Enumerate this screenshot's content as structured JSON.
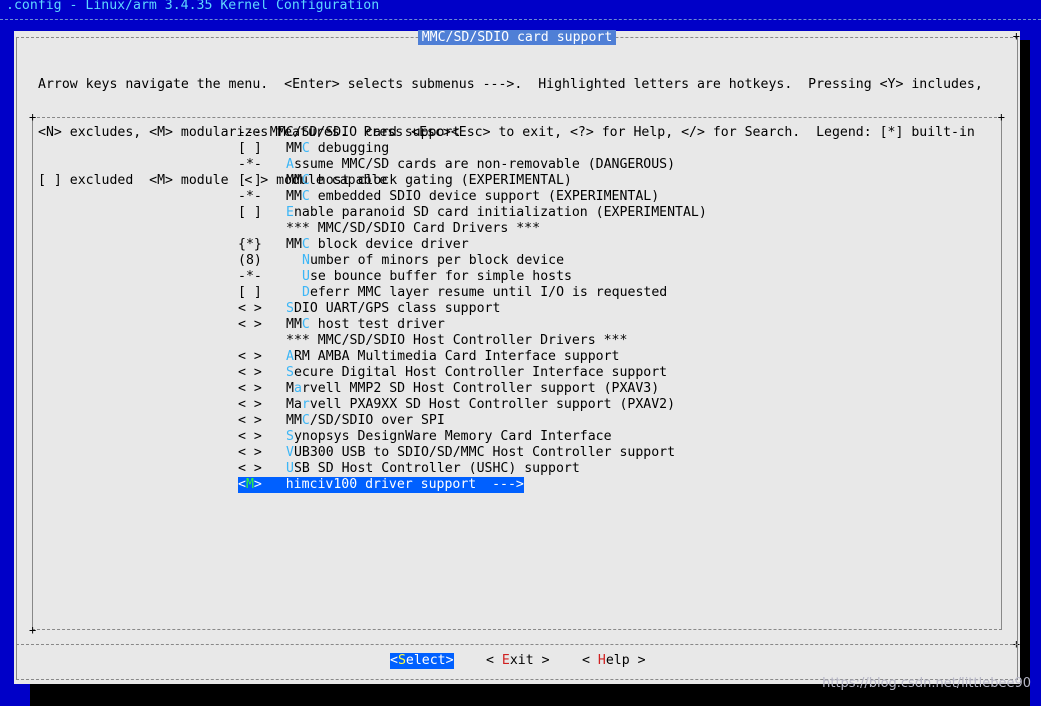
{
  "window": {
    "title": ".config - Linux/arm 3.4.35 Kernel Configuration"
  },
  "dialog": {
    "title": "MMC/SD/SDIO card support",
    "help_lines": [
      "Arrow keys navigate the menu.  <Enter> selects submenus --->.  Highlighted letters are hotkeys.  Pressing <Y> includes,",
      "<N> excludes, <M> modularizes features.  Press <Esc><Esc> to exit, <?> for Help, </> for Search.  Legend: [*] built-in",
      "[ ] excluded  <M> module  < > module capable"
    ]
  },
  "menu": {
    "items": [
      {
        "mark": "",
        "pre": "--- MMC/SD/SDIO card support",
        "hk": "",
        "post": "",
        "indent": false,
        "raw": true
      },
      {
        "mark": "[ ]",
        "pre": "MM",
        "hk": "C",
        "post": " debugging",
        "indent": false
      },
      {
        "mark": "-*-",
        "pre": "",
        "hk": "A",
        "post": "ssume MMC/SD cards are non-removable (DANGEROUS)",
        "indent": false
      },
      {
        "mark": "[ ]",
        "pre": "MM",
        "hk": "C",
        "post": " host clock gating (EXPERIMENTAL)",
        "indent": false
      },
      {
        "mark": "-*-",
        "pre": "MM",
        "hk": "C",
        "post": " embedded SDIO device support (EXPERIMENTAL)",
        "indent": false
      },
      {
        "mark": "[ ]",
        "pre": "",
        "hk": "E",
        "post": "nable paranoid SD card initialization (EXPERIMENTAL)",
        "indent": false
      },
      {
        "mark": "",
        "pre": "*** MMC/SD/SDIO Card Drivers ***",
        "hk": "",
        "post": "",
        "indent": false
      },
      {
        "mark": "{*}",
        "pre": "MM",
        "hk": "C",
        "post": " block device driver",
        "indent": false
      },
      {
        "mark": "(8)",
        "pre": "",
        "hk": "N",
        "post": "umber of minors per block device",
        "indent": true
      },
      {
        "mark": "-*-",
        "pre": "",
        "hk": "U",
        "post": "se bounce buffer for simple hosts",
        "indent": true
      },
      {
        "mark": "[ ]",
        "pre": "",
        "hk": "D",
        "post": "eferr MMC layer resume until I/O is requested",
        "indent": true
      },
      {
        "mark": "< >",
        "pre": "",
        "hk": "S",
        "post": "DIO UART/GPS class support",
        "indent": false
      },
      {
        "mark": "< >",
        "pre": "MM",
        "hk": "C",
        "post": " host test driver",
        "indent": false
      },
      {
        "mark": "",
        "pre": "*** MMC/SD/SDIO Host Controller Drivers ***",
        "hk": "",
        "post": "",
        "indent": false
      },
      {
        "mark": "< >",
        "pre": "",
        "hk": "A",
        "post": "RM AMBA Multimedia Card Interface support",
        "indent": false
      },
      {
        "mark": "< >",
        "pre": "",
        "hk": "S",
        "post": "ecure Digital Host Controller Interface support",
        "indent": false
      },
      {
        "mark": "< >",
        "pre": "M",
        "hk": "a",
        "post": "rvell MMP2 SD Host Controller support (PXAV3)",
        "indent": false
      },
      {
        "mark": "< >",
        "pre": "Ma",
        "hk": "r",
        "post": "vell PXA9XX SD Host Controller support (PXAV2)",
        "indent": false
      },
      {
        "mark": "< >",
        "pre": "MM",
        "hk": "C",
        "post": "/SD/SDIO over SPI",
        "indent": false
      },
      {
        "mark": "< >",
        "pre": "",
        "hk": "S",
        "post": "ynopsys DesignWare Memory Card Interface",
        "indent": false
      },
      {
        "mark": "< >",
        "pre": "",
        "hk": "V",
        "post": "UB300 USB to SDIO/SD/MMC Host Controller support",
        "indent": false
      },
      {
        "mark": "< >",
        "pre": "",
        "hk": "U",
        "post": "SB SD Host Controller (USHC) support",
        "indent": false
      },
      {
        "mark_pre": "<",
        "mark_hk": "M",
        "mark_post": ">",
        "pre": "himciv100 driver support  --->",
        "hk": "",
        "post": "",
        "indent": false,
        "selected": true
      }
    ]
  },
  "buttons": [
    {
      "name": "select-button",
      "pre": "<",
      "hk": "S",
      "post": "elect>",
      "active": true
    },
    {
      "name": "exit-button",
      "pre": "< ",
      "hk": "E",
      "post": "xit >",
      "active": false
    },
    {
      "name": "help-button",
      "pre": "< ",
      "hk": "H",
      "post": "elp >",
      "active": false
    }
  ],
  "watermark": "https://blog.csdn.net/littlebee90"
}
